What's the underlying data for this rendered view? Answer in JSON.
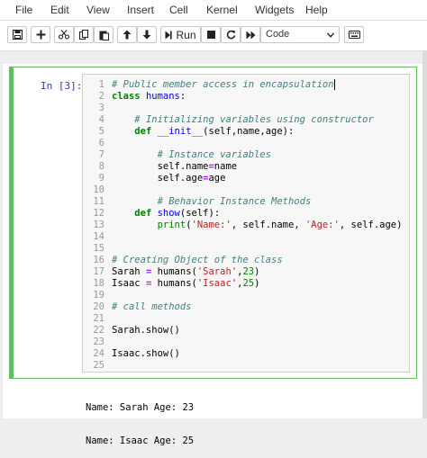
{
  "menu": [
    "File",
    "Edit",
    "View",
    "Insert",
    "Cell",
    "Kernel",
    "Widgets",
    "Help"
  ],
  "toolbar": {
    "buttons": [
      "save",
      "insert-cell",
      "cut",
      "copy",
      "paste",
      "move-up",
      "move-down",
      "run",
      "interrupt",
      "restart",
      "run-all"
    ],
    "run_label": "Run",
    "cell_type": "Code",
    "accent": "#66bb6a"
  },
  "cell": {
    "prompt": "In [3]:",
    "lines": [
      "# Public member access in encapsulation",
      "class humans:",
      "",
      "    # Initializing variables using constructor",
      "    def __init__(self,name,age):",
      "",
      "        # Instance variables",
      "        self.name=name",
      "        self.age=age",
      "",
      "        # Behavior Instance Methods",
      "    def show(self):",
      "        print('Name:', self.name, 'Age:', self.age)",
      "",
      "",
      "# Creating Object of the class",
      "Sarah = humans('Sarah',23)",
      "Isaac = humans('Isaac',25)",
      "",
      "# call methods",
      "",
      "Sarah.show()",
      "",
      "Isaac.show()",
      ""
    ],
    "output": [
      "Name: Sarah Age: 23",
      "Name: Isaac Age: 25"
    ]
  }
}
